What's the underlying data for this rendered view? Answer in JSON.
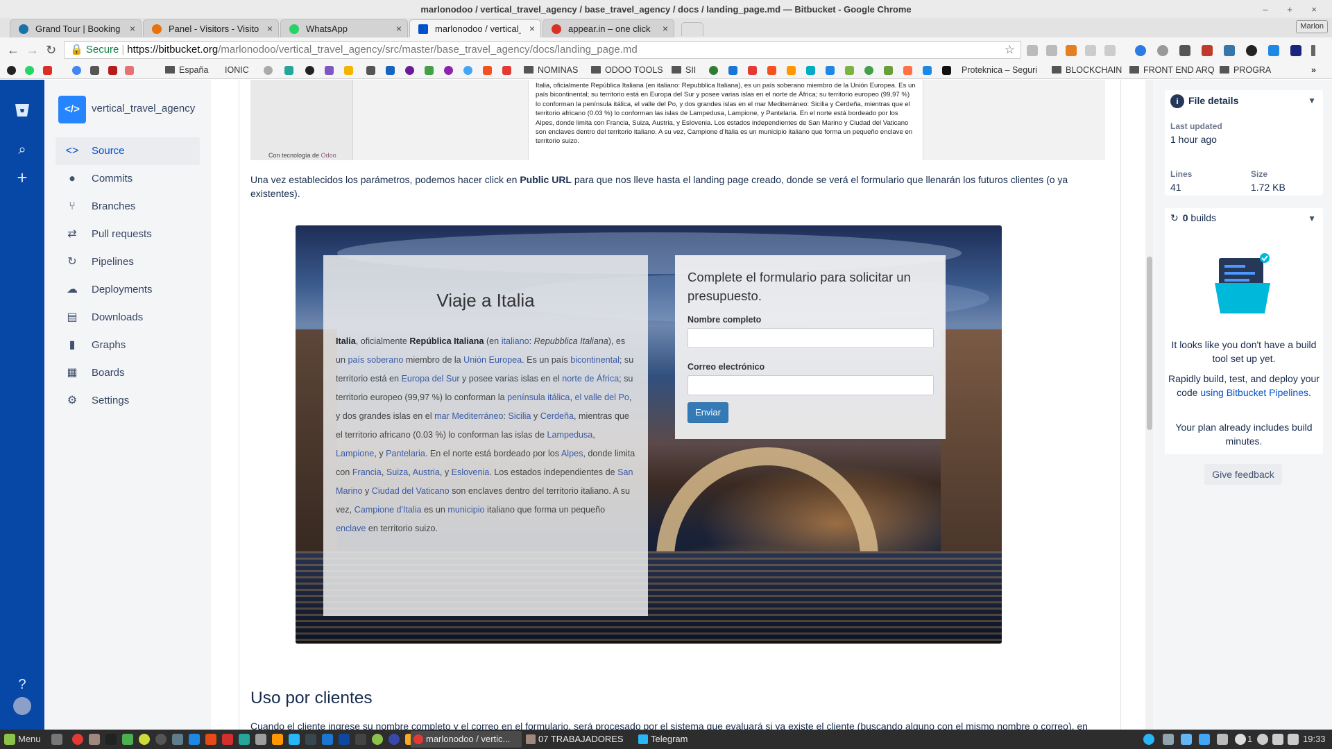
{
  "window": {
    "title": "marlonodoo / vertical_travel_agency / base_travel_agency / docs / landing_page.md — Bitbucket - Google Chrome",
    "controls": "– + ×",
    "user": "Marlon"
  },
  "tabs": [
    {
      "label": "Grand Tour | Booking T",
      "color": "#1a73a8"
    },
    {
      "label": "Panel - Visitors - Visitor",
      "color": "#e8710a"
    },
    {
      "label": "WhatsApp",
      "color": "#25d366"
    },
    {
      "label": "marlonodoo / vertical_tr",
      "color": "#0052cc"
    },
    {
      "label": "appear.in – one click",
      "color": "#d93025"
    }
  ],
  "address": {
    "secure_label": "Secure",
    "host": "https://bitbucket.org",
    "path": "/marlonodoo/vertical_travel_agency/src/master/base_travel_agency/docs/landing_page.md"
  },
  "bookmarks": [
    "España",
    "IONIC",
    "NOMINAS",
    "ODOO TOOLS",
    "SII",
    "Proteknica – Seguri",
    "BLOCKCHAIN",
    "FRONT END ARQ",
    "PROGRA"
  ],
  "sidebar": {
    "repo_name": "vertical_travel_agency",
    "repo_avatar": "</>",
    "items": [
      {
        "label": "Source",
        "icon": "<>"
      },
      {
        "label": "Commits",
        "icon": "⦁"
      },
      {
        "label": "Branches",
        "icon": "⑂"
      },
      {
        "label": "Pull requests",
        "icon": "⇄"
      },
      {
        "label": "Pipelines",
        "icon": "↻"
      },
      {
        "label": "Deployments",
        "icon": "☁"
      },
      {
        "label": "Downloads",
        "icon": "▤"
      },
      {
        "label": "Graphs",
        "icon": "▮"
      },
      {
        "label": "Boards",
        "icon": "▦"
      },
      {
        "label": "Settings",
        "icon": "⚙"
      }
    ]
  },
  "odoo_preview": {
    "credit_prefix": "Con tecnología de",
    "credit_brand": "Odoo",
    "line1": "Italia, oficialmente República Italiana (en italiano: Repubblica Italiana), es un país soberano miembro de la Unión Europea. Es un país bicontinental; su territorio está en Europa del Sur y posee varias islas en el norte de África; su territorio europeo (99,97 %) lo conforman la península itálica, el valle del Po, y dos grandes islas en el mar Mediterráneo: Sicilia y Cerdeña, mientras que el territorio africano (0.03 %) lo conforman las islas de Lampedusa, Lampione, y Pantelaria. En el norte está bordeado por los Alpes, donde limita con Francia, Suiza, Austria, y Eslovenia. Los estados independientes de San Marino y Ciudad del Vaticano son enclaves dentro del territorio italiano. A su vez, Campione d'Italia es un municipio italiano que forma un pequeño enclave en territorio suizo."
  },
  "doc": {
    "para1_a": "Una vez establecidos los parámetros, podemos hacer click en ",
    "para1_b": "Public URL",
    "para1_c": " para que nos lleve hasta el landing page creado, donde se verá el formulario que llenarán los futuros clientes (o ya existentes).",
    "h2": "Uso por clientes",
    "para2": "Cuando el cliente ingrese su nombre completo y el correo en el formulario, será procesado por el sistema que evaluará si ya existe el cliente (buscando alguno con el mismo nombre o correo), en"
  },
  "landing": {
    "title": "Viaje a Italia",
    "body": {
      "t1": "Italia",
      "t2": ", oficialmente ",
      "t3": "República Italiana",
      "t4": " (en ",
      "t5": "italiano",
      "t6": ": ",
      "t7": "Repubblica Italiana",
      "t8": "), es un ",
      "t9": "país soberano",
      "t10": " miembro de la ",
      "t11": "Unión Europea",
      "t12": ". Es un país ",
      "t13": "bicontinental",
      "t14": "; su territorio está en ",
      "t15": "Europa del Sur",
      "t16": " y posee varias islas en el ",
      "t17": "norte de África",
      "t18": "; su territorio europeo (99,97 %) lo conforman la ",
      "t19": "península itálica",
      "t20": ", ",
      "t21": "el valle del Po",
      "t22": ", y dos grandes islas en el ",
      "t23": "mar Mediterráneo",
      "t24": ": ",
      "t25": "Sicilia",
      "t26": " y ",
      "t27": "Cerdeña",
      "t28": ", mientras que el territorio africano (0.03 %) lo conforman las islas de ",
      "t29": "Lampedusa",
      "t30": ", ",
      "t31": "Lampione",
      "t32": ", y ",
      "t33": "Pantelaria",
      "t34": ". En el norte está bordeado por los ",
      "t35": "Alpes",
      "t36": ", donde limita con ",
      "t37": "Francia",
      "t38": ", ",
      "t39": "Suiza",
      "t40": ", ",
      "t41": "Austria",
      "t42": ", y ",
      "t43": "Eslovenia",
      "t44": ". Los estados independientes de ",
      "t45": "San Marino",
      "t46": " y ",
      "t47": "Ciudad del Vaticano",
      "t48": " son enclaves dentro del territorio italiano. A su vez, ",
      "t49": "Campione d'Italia",
      "t50": " es un ",
      "t51": "municipio",
      "t52": " italiano que forma un pequeño ",
      "t53": "enclave",
      "t54": " en territorio suizo."
    },
    "form": {
      "title": "Complete el formulario para solicitar un presupuesto.",
      "name_label": "Nombre completo",
      "name_value": "",
      "email_label": "Correo electrónico",
      "email_value": "",
      "submit": "Enviar"
    }
  },
  "file_details": {
    "header": "File details",
    "last_updated_label": "Last updated",
    "last_updated": "1 hour ago",
    "lines_label": "Lines",
    "lines": "41",
    "size_label": "Size",
    "size": "1.72 KB"
  },
  "builds": {
    "count": "0",
    "label": "builds",
    "msg1": "It looks like you don't have a build tool set up yet.",
    "msg2_a": "Rapidly build, test, and deploy your code ",
    "msg2_link": "using Bitbucket Pipelines",
    "msg2_b": ".",
    "msg3": "Your plan already includes build minutes.",
    "feedback": "Give feedback"
  },
  "taskbar": {
    "menu": "Menu",
    "windows": [
      {
        "label": "marlonodoo / vertic...",
        "active": true
      },
      {
        "label": "07 TRABAJADORES",
        "active": false
      },
      {
        "label": "Telegram",
        "active": false
      }
    ],
    "clock": "19:33",
    "count": "1"
  }
}
